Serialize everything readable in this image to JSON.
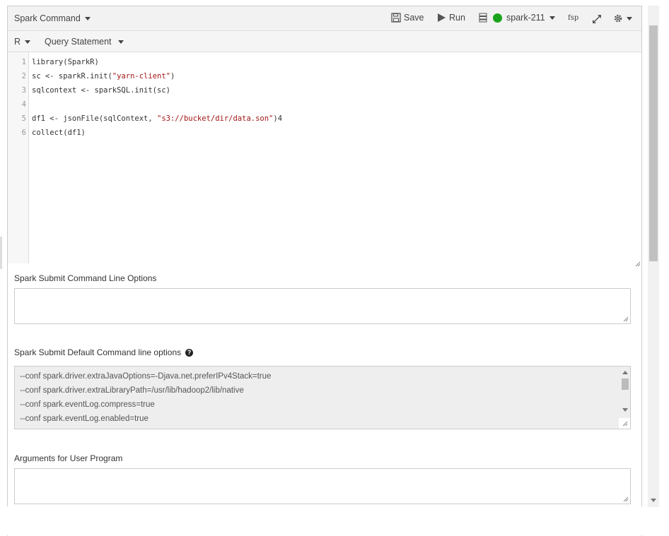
{
  "toolbar": {
    "title": "Spark Command",
    "save_label": "Save",
    "run_label": "Run",
    "cluster_label": "spark-211",
    "cluster_status_color": "#1aa31a",
    "fsp_label": "fsp",
    "icons": [
      "save-icon",
      "play-icon",
      "server-icon",
      "status-dot-icon",
      "expand-icon",
      "gear-icon"
    ]
  },
  "subbar": {
    "language": "R",
    "mode": "Query Statement"
  },
  "editor": {
    "lines": [
      {
        "num": "1",
        "pre": "library(SparkR)",
        "str": "",
        "post": ""
      },
      {
        "num": "2",
        "pre": "sc <- sparkR.init(",
        "str": "\"yarn-client\"",
        "post": ")"
      },
      {
        "num": "3",
        "pre": "sqlcontext <- sparkSQL.init(sc)",
        "str": "",
        "post": ""
      },
      {
        "num": "4",
        "pre": "",
        "str": "",
        "post": ""
      },
      {
        "num": "5",
        "pre": "df1 <- jsonFile(sqlContext, ",
        "str": "\"s3://bucket/dir/data.son\"",
        "post": ")4"
      },
      {
        "num": "6",
        "pre": "collect(df1)",
        "str": "",
        "post": ""
      }
    ]
  },
  "fields": {
    "submit_options_label": "Spark Submit Command Line Options",
    "submit_options_value": "",
    "default_options_label": "Spark Submit Default Command line options",
    "default_options": [
      "--conf spark.driver.extraJavaOptions=-Djava.net.preferIPv4Stack=true",
      "--conf spark.driver.extraLibraryPath=/usr/lib/hadoop2/lib/native",
      "--conf spark.eventLog.compress=true",
      "--conf spark.eventLog.enabled=true"
    ],
    "arguments_label": "Arguments for User Program",
    "arguments_value": ""
  }
}
